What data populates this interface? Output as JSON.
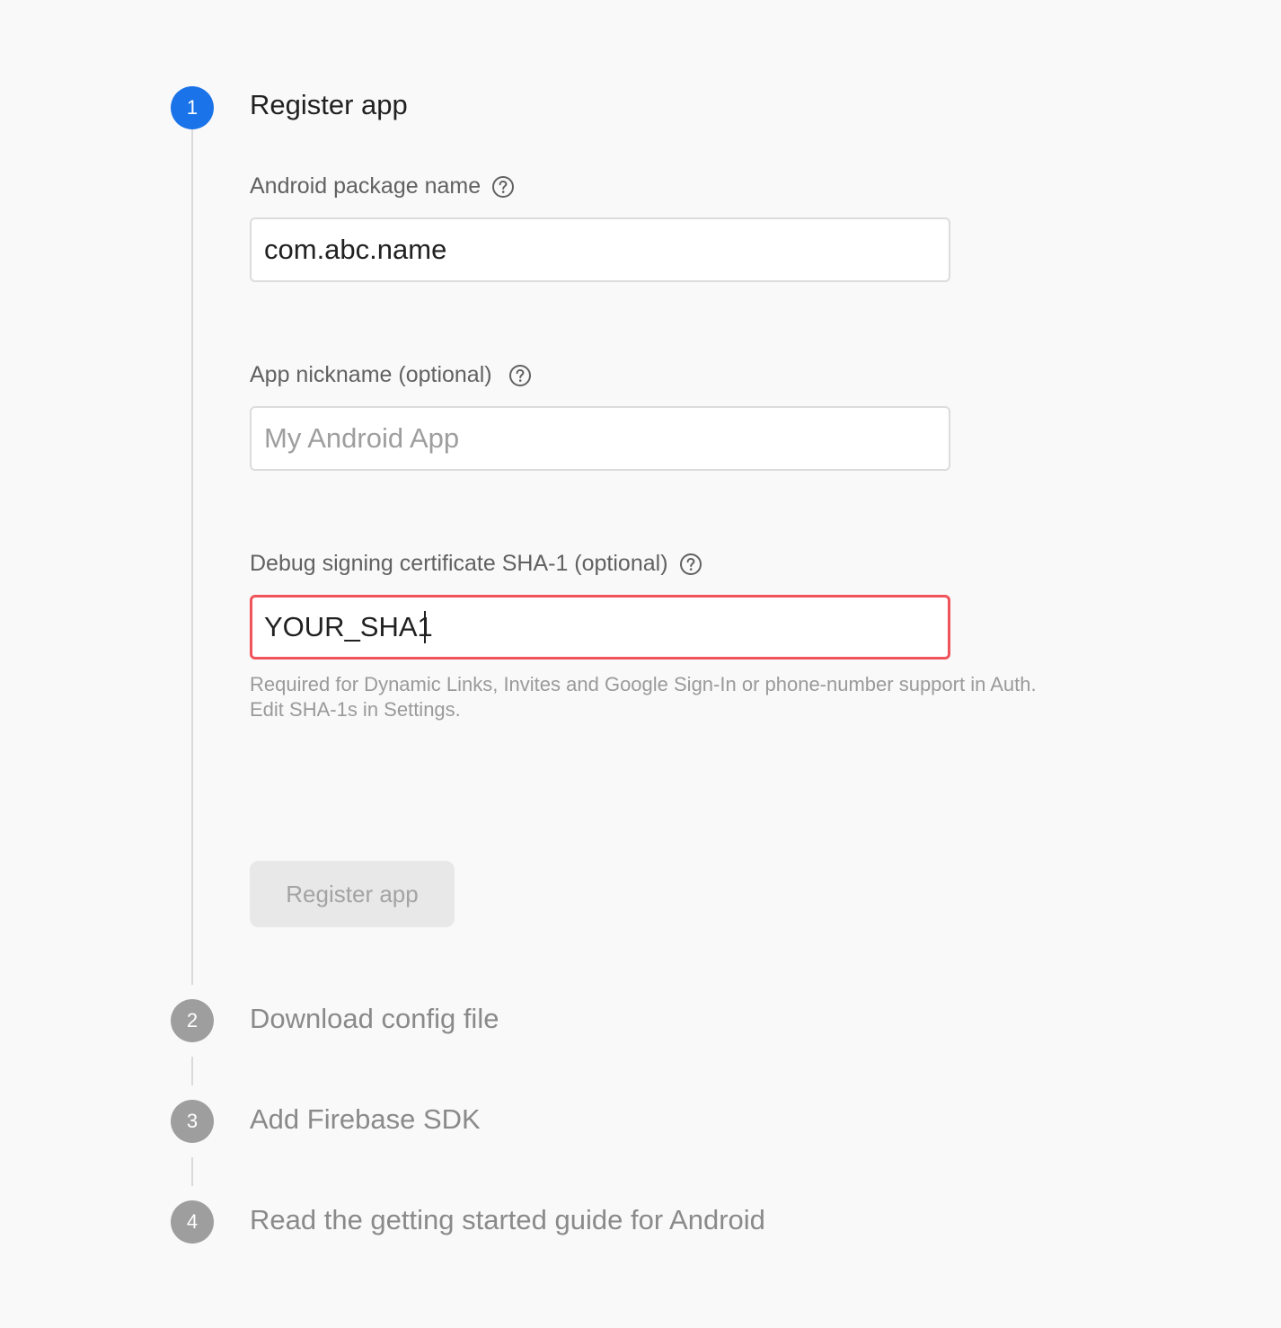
{
  "steps": [
    {
      "number": "1",
      "title": "Register app"
    },
    {
      "number": "2",
      "title": "Download config file"
    },
    {
      "number": "3",
      "title": "Add Firebase SDK"
    },
    {
      "number": "4",
      "title": "Read the getting started guide for Android"
    }
  ],
  "form": {
    "package_name": {
      "label": "Android package name",
      "value": "com.abc.name"
    },
    "nickname": {
      "label": "App nickname (optional)",
      "value": "",
      "placeholder": "My Android App"
    },
    "sha1": {
      "label": "Debug signing certificate SHA-1 (optional)",
      "value": "YOUR_SHA1",
      "hint": "Required for Dynamic Links, Invites and Google Sign-In or phone-number support in Auth. Edit SHA-1s in Settings."
    },
    "register_button": "Register app"
  },
  "colors": {
    "active_step": "#1a73e8",
    "inactive_step": "#9e9e9e",
    "error_border": "#f0535a",
    "background": "#f9f9f9"
  }
}
